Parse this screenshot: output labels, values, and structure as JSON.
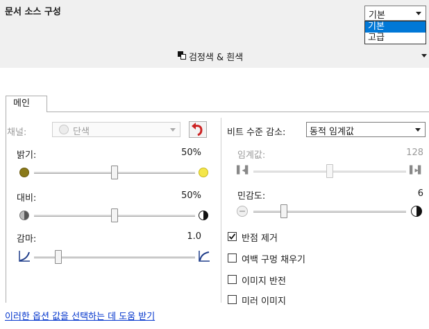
{
  "header": {
    "title": "문서 소스 구성"
  },
  "profile_select": {
    "value": "기본",
    "options": [
      "기본",
      "고급"
    ],
    "selected_index": 0
  },
  "color_mode_select": {
    "value": "검정색 & 흰색",
    "icon": "black-white-icon"
  },
  "tabs": [
    {
      "label": "메인"
    }
  ],
  "left_panel": {
    "channel": {
      "label": "채널:",
      "value": "단색",
      "disabled": true
    },
    "brightness": {
      "label": "밝기:",
      "value": "50%",
      "level": 0.5
    },
    "contrast": {
      "label": "대비:",
      "value": "50%",
      "level": 0.5
    },
    "gamma": {
      "label": "감마:",
      "value": "1.0",
      "level": 0.15
    }
  },
  "right_panel": {
    "bit_reduction": {
      "label": "비트 수준 감소:",
      "value": "동적 임계값"
    },
    "threshold": {
      "label": "임계값:",
      "value": "128",
      "level": 0.5,
      "disabled": true
    },
    "sensitivity": {
      "label": "민감도:",
      "value": "6",
      "level": 0.2
    },
    "checkboxes": [
      {
        "label": "반점 제거",
        "checked": true
      },
      {
        "label": "여백 구멍 채우기",
        "checked": false
      },
      {
        "label": "이미지 반전",
        "checked": false
      },
      {
        "label": "미러 이미지",
        "checked": false
      }
    ]
  },
  "help_link": {
    "text": "이러한 옵션 값을 선택하는 데 도움 받기"
  },
  "colors": {
    "accent": "#0078d7",
    "link": "#0033cc",
    "undo_red": "#cc2222"
  }
}
